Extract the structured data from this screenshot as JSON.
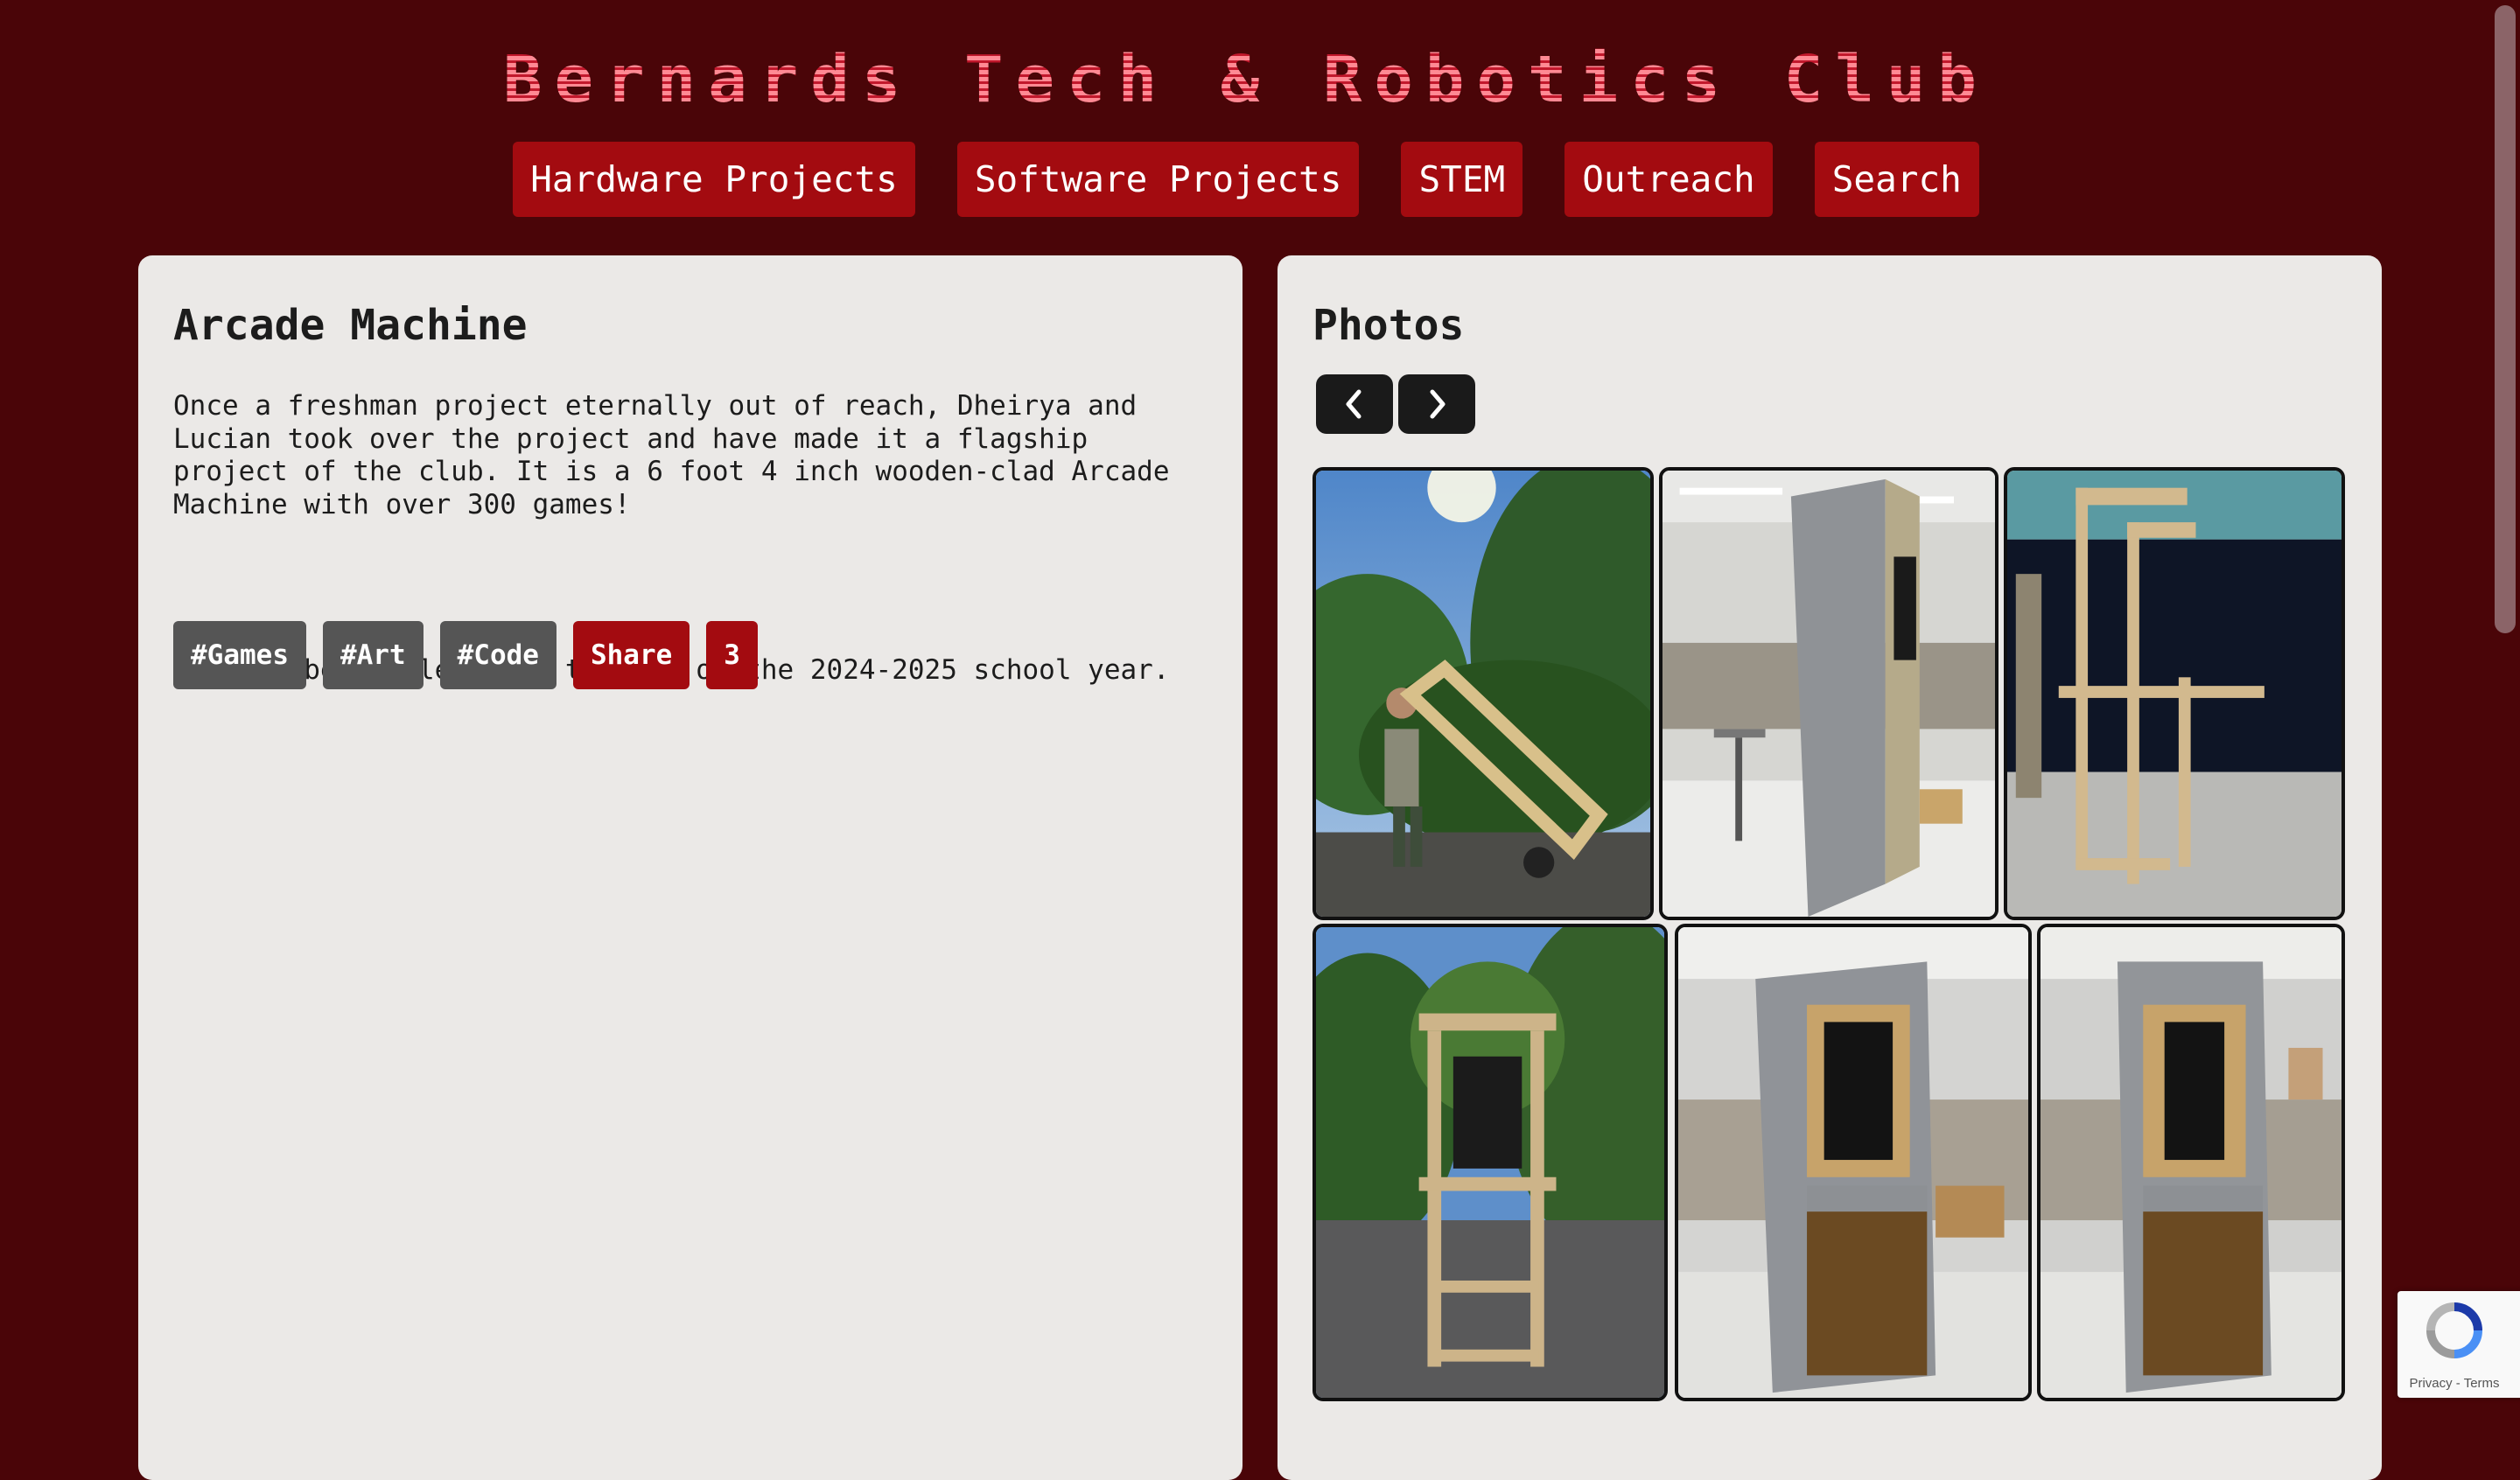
{
  "site": {
    "title": "Bernards Tech & Robotics Club"
  },
  "nav": {
    "items": [
      {
        "label": "Hardware Projects"
      },
      {
        "label": "Software Projects"
      },
      {
        "label": "STEM"
      },
      {
        "label": "Outreach"
      },
      {
        "label": "Search"
      }
    ]
  },
  "project": {
    "title": "Arcade Machine",
    "description": "Once a freshman project eternally out of reach, Dheirya and Lucian took over the project and have made it a flagship project of the club. It is a 6 foot 4 inch wooden-clad Arcade Machine with over 300 games!",
    "completion": "It will be completed by the end of the 2024-2025 school year.",
    "tags": [
      "#Games",
      "#Art",
      "#Code"
    ],
    "share_label": "Share",
    "share_count": "3"
  },
  "photos": {
    "heading": "Photos",
    "prev_icon": "chevron-left-icon",
    "next_icon": "chevron-right-icon"
  },
  "recaptcha": {
    "privacy": "Privacy",
    "terms": "Terms"
  },
  "colors": {
    "background": "#4a0508",
    "accent": "#a30b10",
    "card": "#ebe9e7",
    "tag": "#555555"
  }
}
